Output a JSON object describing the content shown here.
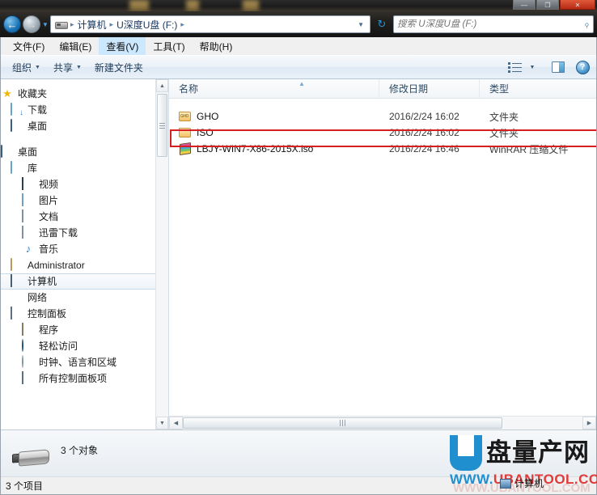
{
  "window": {
    "controls": {
      "minimize": "—",
      "maximize": "❐",
      "close": "✕"
    }
  },
  "addressbar": {
    "back_icon": "back-arrow-icon",
    "forward_icon": "forward-arrow-icon",
    "history_icon": "history-dropdown-icon",
    "drive_icon": "removable-drive-icon",
    "crumbs": [
      "计算机",
      "U深度U盘 (F:)"
    ],
    "separator": "▸",
    "dropdown_caret": "▼",
    "refresh_icon": "refresh-icon"
  },
  "search": {
    "placeholder": "搜索 U深度U盘 (F:)",
    "value": "",
    "icon": "search-magnifier-icon"
  },
  "menubar": {
    "items": [
      {
        "label": "文件(F)",
        "active": false
      },
      {
        "label": "编辑(E)",
        "active": false
      },
      {
        "label": "查看(V)",
        "active": true
      },
      {
        "label": "工具(T)",
        "active": false
      },
      {
        "label": "帮助(H)",
        "active": false
      }
    ]
  },
  "toolbar": {
    "organize_label": "组织",
    "share_label": "共享",
    "newfolder_label": "新建文件夹",
    "caret": "▼",
    "view_icon": "view-options-icon",
    "view_caret": "▼",
    "preview_icon": "preview-pane-icon",
    "help_icon": "help-icon",
    "help_glyph": "?"
  },
  "navpane": {
    "items": [
      {
        "label": "收藏夹",
        "icon": "star-icon",
        "indent": 0,
        "selected": false
      },
      {
        "label": "下载",
        "icon": "downloads-folder-icon",
        "indent": 1,
        "selected": false
      },
      {
        "label": "桌面",
        "icon": "desktop-icon",
        "indent": 1,
        "selected": false
      },
      {
        "label": "桌面",
        "icon": "desktop-icon",
        "indent": 0,
        "selected": false
      },
      {
        "label": "库",
        "icon": "library-folder-icon",
        "indent": 1,
        "selected": false
      },
      {
        "label": "视频",
        "icon": "video-library-icon",
        "indent": 2,
        "selected": false
      },
      {
        "label": "图片",
        "icon": "pictures-library-icon",
        "indent": 2,
        "selected": false
      },
      {
        "label": "文档",
        "icon": "documents-library-icon",
        "indent": 2,
        "selected": false
      },
      {
        "label": "迅雷下载",
        "icon": "thunder-download-icon",
        "indent": 2,
        "selected": false
      },
      {
        "label": "音乐",
        "icon": "music-library-icon",
        "indent": 2,
        "selected": false
      },
      {
        "label": "Administrator",
        "icon": "user-folder-icon",
        "indent": 1,
        "selected": false
      },
      {
        "label": "计算机",
        "icon": "computer-icon",
        "indent": 1,
        "selected": true
      },
      {
        "label": "网络",
        "icon": "network-icon",
        "indent": 1,
        "selected": false
      },
      {
        "label": "控制面板",
        "icon": "control-panel-icon",
        "indent": 1,
        "selected": false
      },
      {
        "label": "程序",
        "icon": "programs-icon",
        "indent": 2,
        "selected": false
      },
      {
        "label": "轻松访问",
        "icon": "ease-of-access-icon",
        "indent": 2,
        "selected": false
      },
      {
        "label": "时钟、语言和区域",
        "icon": "clock-language-region-icon",
        "indent": 2,
        "selected": false
      },
      {
        "label": "所有控制面板项",
        "icon": "control-panel-icon",
        "indent": 2,
        "selected": false
      }
    ],
    "scroll_up": "▲",
    "scroll_down": "▼"
  },
  "filelist": {
    "columns": [
      "名称",
      "修改日期",
      "类型"
    ],
    "sort_indicator": "▲",
    "rows": [
      {
        "name": "GHO",
        "date": "2016/2/24 16:02",
        "type": "文件夹",
        "icon": "gho-folder-icon",
        "highlighted": false
      },
      {
        "name": "ISO",
        "date": "2016/2/24 16:02",
        "type": "文件夹",
        "icon": "folder-icon",
        "highlighted": false
      },
      {
        "name": "LBJY-WIN7-X86-2015X.iso",
        "date": "2016/2/24 16:46",
        "type": "WinRAR 压缩文件",
        "icon": "winrar-archive-icon",
        "highlighted": true
      }
    ],
    "highlight_color": "#d81f1f",
    "hscroll_left": "◀",
    "hscroll_right": "▶"
  },
  "details": {
    "object_count": "3 个对象",
    "icon": "usb-flash-drive-icon"
  },
  "statusbar": {
    "text": "3 个项目"
  },
  "watermark": {
    "logo_letter": "U",
    "logo_text": "盘量产网",
    "url_www": "WWW.",
    "url_domain": "UBANTOOL.COM",
    "ghost_text": "WWW.UBANTOOL.COM",
    "taskbar_label": "计算机"
  }
}
